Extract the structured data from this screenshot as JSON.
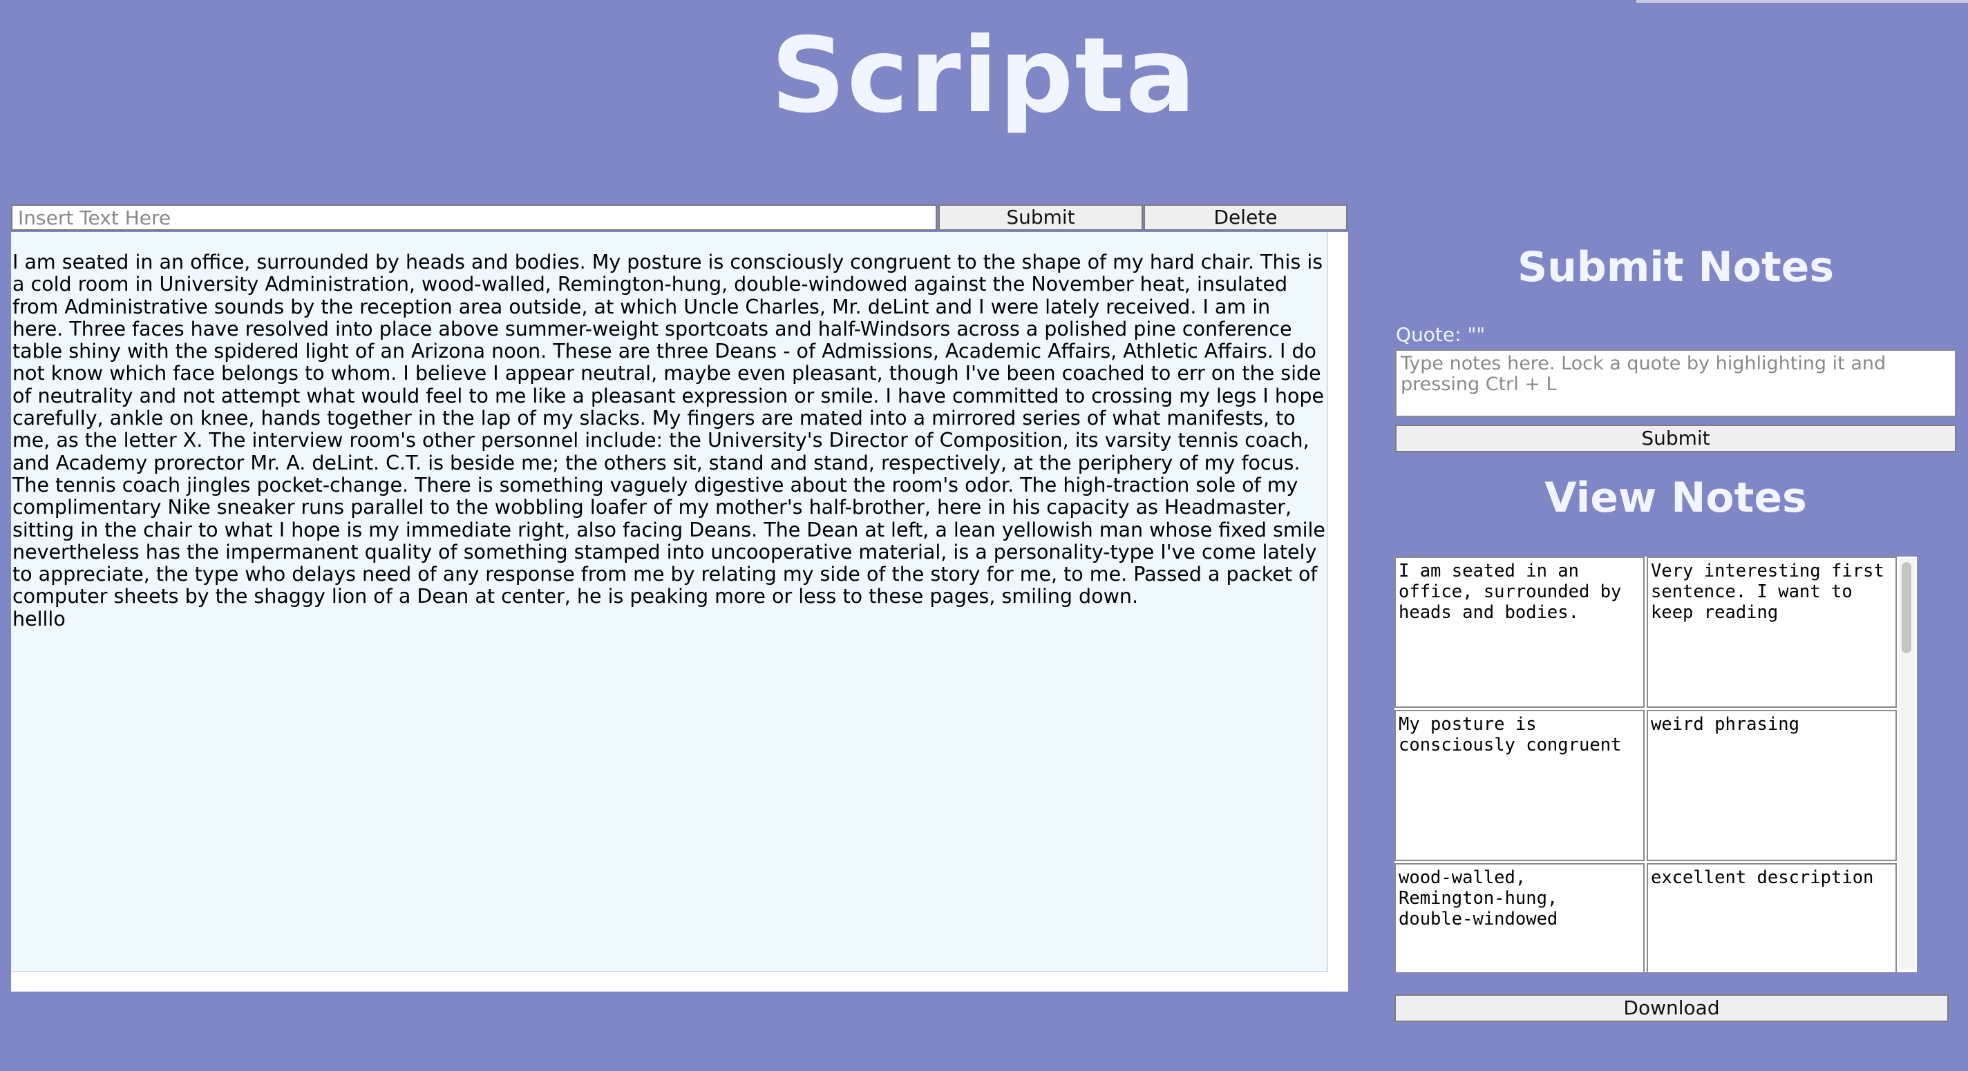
{
  "app": {
    "title": "Scripta"
  },
  "editor": {
    "input_placeholder": "Insert Text Here",
    "submit_label": "Submit",
    "delete_label": "Delete",
    "paragraphs": [
      "I am seated in an office, surrounded by heads and bodies. My posture is consciously congruent to the shape of my hard chair. This is a cold room in University Administration, wood-walled, Remington-hung, double-windowed against the November heat, insulated from Administrative sounds by the reception area outside, at which Uncle Charles, Mr. deLint and I were lately received. I am in here. Three faces have resolved into place above summer-weight sportcoats and half-Windsors across a polished pine conference table shiny with the spidered light of an Arizona noon. These are three Deans - of Admissions, Academic Affairs, Athletic Affairs. I do not know which face belongs to whom. I believe I appear neutral, maybe even pleasant, though I've been coached to err on the side of neutrality and not attempt what would feel to me like a pleasant expression or smile. I have committed to crossing my legs I hope carefully, ankle on knee, hands together in the lap of my slacks. My fingers are mated into a mirrored series of what manifests, to me, as the letter X. The interview room's other personnel include: the University's Director of Composition, its varsity tennis coach, and Academy prorector Mr. A. deLint. C.T. is beside me; the others sit, stand and stand, respectively, at the periphery of my focus. The tennis coach jingles pocket-change. There is something vaguely digestive about the room's odor. The high-traction sole of my complimentary Nike sneaker runs parallel to the wobbling loafer of my mother's half-brother, here in his capacity as Headmaster, sitting in the chair to what I hope is my immediate right, also facing Deans. The Dean at left, a lean yellowish man whose fixed smile nevertheless has the impermanent quality of something stamped into uncooperative material, is a personality-type I've come lately to appreciate, the type who delays need of any response from me by relating my side of the story for me, to me. Passed a packet of computer sheets by the shaggy lion of a Dean at center, he is peaking more or less to these pages, smiling down.",
      "helllo"
    ]
  },
  "submit_notes": {
    "heading": "Submit Notes",
    "quote_label": "Quote: \"\"",
    "notes_placeholder": "Type notes here. Lock a quote by highlighting it and pressing Ctrl + L",
    "submit_label": "Submit"
  },
  "view_notes": {
    "heading": "View Notes",
    "rows": [
      {
        "quote": "I am seated in an office, surrounded by heads and bodies.",
        "note": "Very interesting first sentence. I want to keep reading"
      },
      {
        "quote": "My posture is consciously congruent",
        "note": "weird phrasing"
      },
      {
        "quote": "wood-walled, Remington-hung, double-windowed",
        "note": "excellent description"
      }
    ],
    "download_label": "Download"
  }
}
